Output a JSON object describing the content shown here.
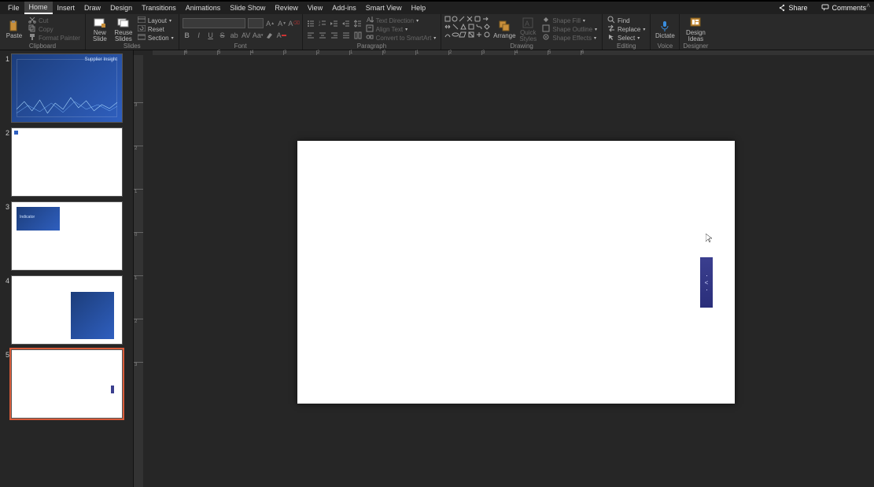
{
  "menu": {
    "items": [
      "File",
      "Home",
      "Insert",
      "Draw",
      "Design",
      "Transitions",
      "Animations",
      "Slide Show",
      "Review",
      "View",
      "Add-ins",
      "Smart View",
      "Help"
    ],
    "active_index": 1,
    "share": "Share",
    "comments": "Comments"
  },
  "ribbon": {
    "clipboard": {
      "paste": "Paste",
      "cut": "Cut",
      "copy": "Copy",
      "format_painter": "Format Painter",
      "label": "Clipboard"
    },
    "slides": {
      "new_slide": "New\nSlide",
      "reuse_slides": "Reuse\nSlides",
      "layout": "Layout",
      "reset": "Reset",
      "section": "Section",
      "label": "Slides"
    },
    "font": {
      "name_placeholder": "",
      "size_placeholder": "",
      "label": "Font"
    },
    "paragraph": {
      "text_direction": "Text Direction",
      "align_text": "Align Text",
      "convert_smartart": "Convert to SmartArt",
      "label": "Paragraph"
    },
    "drawing": {
      "arrange": "Arrange",
      "quick_styles": "Quick\nStyles",
      "shape_fill": "Shape Fill",
      "shape_outline": "Shape Outline",
      "shape_effects": "Shape Effects",
      "label": "Drawing"
    },
    "editing": {
      "find": "Find",
      "replace": "Replace",
      "select": "Select",
      "label": "Editing"
    },
    "voice": {
      "dictate": "Dictate",
      "label": "Voice"
    },
    "designer": {
      "design_ideas": "Design\nIdeas",
      "label": "Designer"
    }
  },
  "thumbnails": [
    {
      "num": "1",
      "type": "dashboard",
      "title": "Supplier Insight"
    },
    {
      "num": "2",
      "type": "blank_dot"
    },
    {
      "num": "3",
      "type": "small_blue",
      "title": "Indicator"
    },
    {
      "num": "4",
      "type": "offset_blue"
    },
    {
      "num": "5",
      "type": "current_slit",
      "selected": true
    }
  ],
  "canvas_shape": {
    "glyph": "<"
  },
  "rulers": {
    "h_ticks": [
      "6",
      "5",
      "4",
      "3",
      "2",
      "1",
      "0",
      "1",
      "2",
      "3",
      "4",
      "5",
      "6"
    ],
    "v_ticks": [
      "3",
      "2",
      "1",
      "0",
      "1",
      "2",
      "3"
    ]
  }
}
